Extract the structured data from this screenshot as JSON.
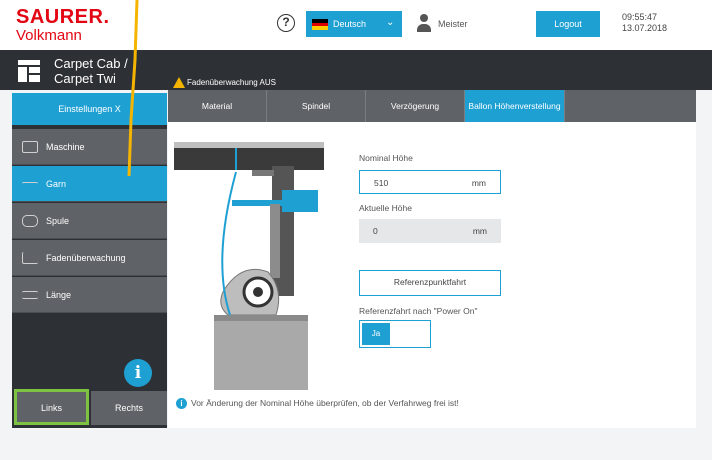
{
  "brand": {
    "line1": "SAURER.",
    "line2": "Volkmann",
    "color": "#e30613"
  },
  "topbar": {
    "help_symbol": "?",
    "language": "Deutsch",
    "user": "Meister",
    "logout_label": "Logout",
    "time": "09:55:47",
    "date": "13.07.2018"
  },
  "header": {
    "machine_title_line1": "Carpet Cab /",
    "machine_title_line2": "Carpet Twi"
  },
  "warning": {
    "text": "Fadenüberwachung AUS"
  },
  "sidebar": {
    "top_label": "Einstellungen X",
    "items": [
      {
        "label": "Maschine",
        "icon": "machine-icon"
      },
      {
        "label": "Garn",
        "icon": "yarn-icon",
        "active": true
      },
      {
        "label": "Spule",
        "icon": "spool-icon"
      },
      {
        "label": "Fadenüberwachung",
        "icon": "thread-monitor-icon"
      },
      {
        "label": "Länge",
        "icon": "length-icon"
      }
    ],
    "info_symbol": "i",
    "left_button": "Links",
    "right_button": "Rechts"
  },
  "tabs": [
    {
      "label": "Material"
    },
    {
      "label": "Spindel"
    },
    {
      "label": "Verzögerung"
    },
    {
      "label": "Ballon Höhenverstellung",
      "active": true
    }
  ],
  "form": {
    "nominal_label": "Nominal Höhe",
    "nominal_value": "510",
    "nominal_unit": "mm",
    "actual_label": "Aktuelle Höhe",
    "actual_value": "0",
    "actual_unit": "mm",
    "reference_button": "Referenzpunktfahrt",
    "reference_power_label": "Referenzfahrt nach \"Power On\"",
    "toggle_label": "Ja"
  },
  "note": {
    "symbol": "i",
    "text": "Vor Änderung der Nominal Höhe überprüfen, ob der Verfahrweg frei ist!"
  },
  "colors": {
    "accent": "#1ea0d3",
    "dark": "#2d3135",
    "nav": "#5f6367",
    "warning": "#f5b400",
    "highlight": "#7dc242"
  }
}
